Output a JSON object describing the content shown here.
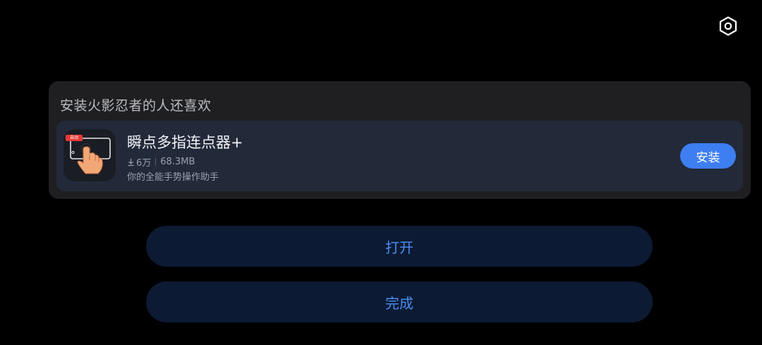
{
  "icons": {
    "settings": "settings-hexagon-icon",
    "download": "download-icon"
  },
  "colors": {
    "background": "#000000",
    "card": "#1f1f21",
    "app_row": "#222a3a",
    "install_button": "#3d7ef2",
    "action_button": "#0c1a33",
    "action_text": "#4a8cf0"
  },
  "recommendation": {
    "title": "安装火影忍者的人还喜欢",
    "app": {
      "icon_badge": "自动",
      "name": "瞬点多指连点器+",
      "downloads": "6万",
      "size": "68.3MB",
      "description": "你的全能手势操作助手",
      "install_label": "安装"
    }
  },
  "actions": {
    "open_label": "打开",
    "done_label": "完成"
  }
}
